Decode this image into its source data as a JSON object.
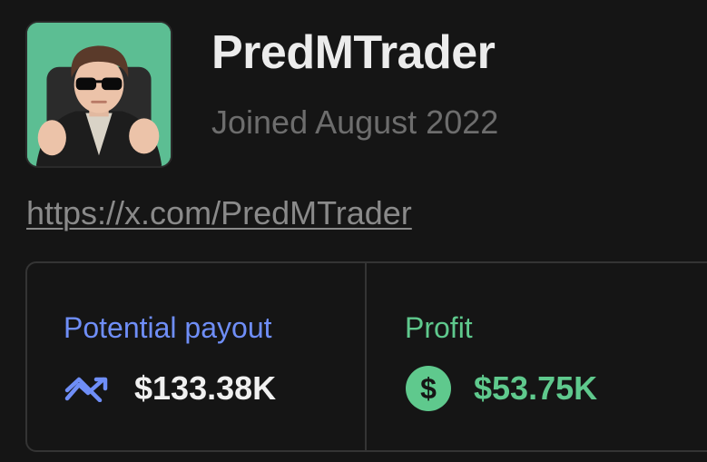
{
  "profile": {
    "username": "PredMTrader",
    "joined": "Joined August 2022",
    "link": "https://x.com/PredMTrader",
    "avatar_icon": "user-avatar-photo"
  },
  "stats": {
    "potential_payout": {
      "label": "Potential payout",
      "value": "$133.38K",
      "icon": "trend-up-icon",
      "label_color": "#6f8ef7"
    },
    "profit": {
      "label": "Profit",
      "value": "$53.75K",
      "icon": "dollar-circle-icon",
      "color": "#5fc98d"
    }
  }
}
